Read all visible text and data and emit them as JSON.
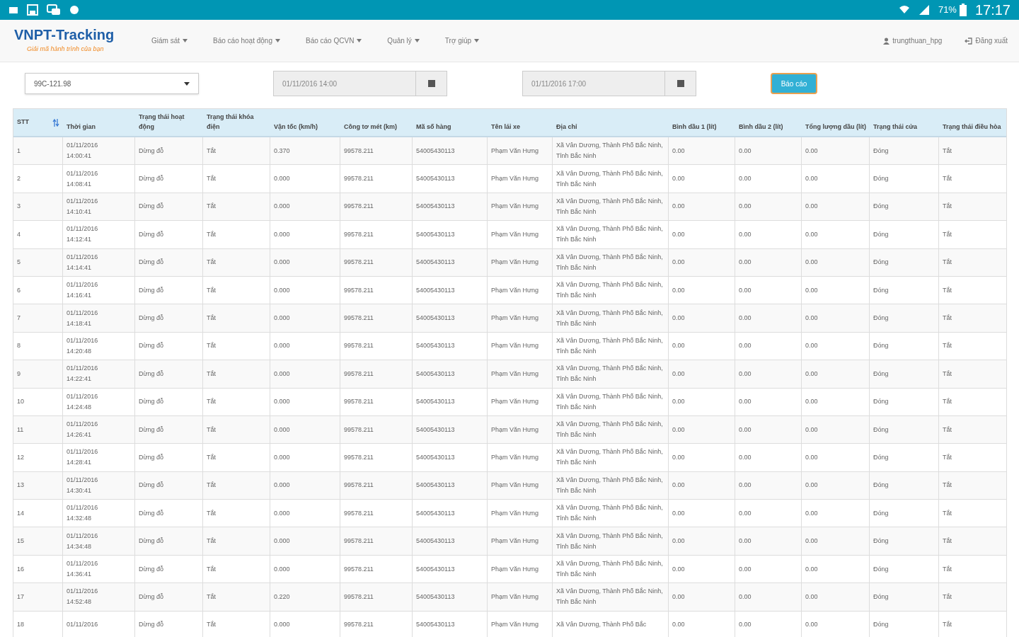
{
  "status_bar": {
    "battery": "71%",
    "time": "17:17"
  },
  "navbar": {
    "logo": "VNPT-Tracking",
    "logo_tagline": "Giải mã hành trình của bạn",
    "menu": [
      {
        "label": "Giám sát"
      },
      {
        "label": "Báo cáo hoạt động"
      },
      {
        "label": "Báo cáo QCVN"
      },
      {
        "label": "Quản lý"
      },
      {
        "label": "Trợ giúp"
      }
    ],
    "user": "trungthuan_hpg",
    "logout": "Đăng xuất"
  },
  "filters": {
    "vehicle": "99C-121.98",
    "from": "01/11/2016 14:00",
    "to": "01/11/2016 17:00",
    "report_button": "Báo cáo"
  },
  "table": {
    "columns": [
      "STT",
      "Thời gian",
      "Trạng thái hoạt động",
      "Trạng thái khóa điện",
      "Vận tốc (km/h)",
      "Công tơ mét (km)",
      "Mã số hàng",
      "Tên lái xe",
      "Địa chỉ",
      "Bình dầu 1 (lít)",
      "Bình dầu 2 (lít)",
      "Tổng lượng dầu (lít)",
      "Trạng thái cửa",
      "Trạng thái điều hòa"
    ],
    "rows": [
      [
        "1",
        "01/11/2016 14:00:41",
        "Dừng đỗ",
        "Tắt",
        "0.370",
        "99578.211",
        "54005430113",
        "Phạm Văn Hưng",
        "Xã Vân Dương, Thành Phố Bắc Ninh, Tỉnh Bắc Ninh",
        "0.00",
        "0.00",
        "0.00",
        "Đóng",
        "Tắt"
      ],
      [
        "2",
        "01/11/2016 14:08:41",
        "Dừng đỗ",
        "Tắt",
        "0.000",
        "99578.211",
        "54005430113",
        "Phạm Văn Hưng",
        "Xã Vân Dương, Thành Phố Bắc Ninh, Tỉnh Bắc Ninh",
        "0.00",
        "0.00",
        "0.00",
        "Đóng",
        "Tắt"
      ],
      [
        "3",
        "01/11/2016 14:10:41",
        "Dừng đỗ",
        "Tắt",
        "0.000",
        "99578.211",
        "54005430113",
        "Phạm Văn Hưng",
        "Xã Vân Dương, Thành Phố Bắc Ninh, Tỉnh Bắc Ninh",
        "0.00",
        "0.00",
        "0.00",
        "Đóng",
        "Tắt"
      ],
      [
        "4",
        "01/11/2016 14:12:41",
        "Dừng đỗ",
        "Tắt",
        "0.000",
        "99578.211",
        "54005430113",
        "Phạm Văn Hưng",
        "Xã Vân Dương, Thành Phố Bắc Ninh, Tỉnh Bắc Ninh",
        "0.00",
        "0.00",
        "0.00",
        "Đóng",
        "Tắt"
      ],
      [
        "5",
        "01/11/2016 14:14:41",
        "Dừng đỗ",
        "Tắt",
        "0.000",
        "99578.211",
        "54005430113",
        "Phạm Văn Hưng",
        "Xã Vân Dương, Thành Phố Bắc Ninh, Tỉnh Bắc Ninh",
        "0.00",
        "0.00",
        "0.00",
        "Đóng",
        "Tắt"
      ],
      [
        "6",
        "01/11/2016 14:16:41",
        "Dừng đỗ",
        "Tắt",
        "0.000",
        "99578.211",
        "54005430113",
        "Phạm Văn Hưng",
        "Xã Vân Dương, Thành Phố Bắc Ninh, Tỉnh Bắc Ninh",
        "0.00",
        "0.00",
        "0.00",
        "Đóng",
        "Tắt"
      ],
      [
        "7",
        "01/11/2016 14:18:41",
        "Dừng đỗ",
        "Tắt",
        "0.000",
        "99578.211",
        "54005430113",
        "Phạm Văn Hưng",
        "Xã Vân Dương, Thành Phố Bắc Ninh, Tỉnh Bắc Ninh",
        "0.00",
        "0.00",
        "0.00",
        "Đóng",
        "Tắt"
      ],
      [
        "8",
        "01/11/2016 14:20:48",
        "Dừng đỗ",
        "Tắt",
        "0.000",
        "99578.211",
        "54005430113",
        "Phạm Văn Hưng",
        "Xã Vân Dương, Thành Phố Bắc Ninh, Tỉnh Bắc Ninh",
        "0.00",
        "0.00",
        "0.00",
        "Đóng",
        "Tắt"
      ],
      [
        "9",
        "01/11/2016 14:22:41",
        "Dừng đỗ",
        "Tắt",
        "0.000",
        "99578.211",
        "54005430113",
        "Phạm Văn Hưng",
        "Xã Vân Dương, Thành Phố Bắc Ninh, Tỉnh Bắc Ninh",
        "0.00",
        "0.00",
        "0.00",
        "Đóng",
        "Tắt"
      ],
      [
        "10",
        "01/11/2016 14:24:48",
        "Dừng đỗ",
        "Tắt",
        "0.000",
        "99578.211",
        "54005430113",
        "Phạm Văn Hưng",
        "Xã Vân Dương, Thành Phố Bắc Ninh, Tỉnh Bắc Ninh",
        "0.00",
        "0.00",
        "0.00",
        "Đóng",
        "Tắt"
      ],
      [
        "11",
        "01/11/2016 14:26:41",
        "Dừng đỗ",
        "Tắt",
        "0.000",
        "99578.211",
        "54005430113",
        "Phạm Văn Hưng",
        "Xã Vân Dương, Thành Phố Bắc Ninh, Tỉnh Bắc Ninh",
        "0.00",
        "0.00",
        "0.00",
        "Đóng",
        "Tắt"
      ],
      [
        "12",
        "01/11/2016 14:28:41",
        "Dừng đỗ",
        "Tắt",
        "0.000",
        "99578.211",
        "54005430113",
        "Phạm Văn Hưng",
        "Xã Vân Dương, Thành Phố Bắc Ninh, Tỉnh Bắc Ninh",
        "0.00",
        "0.00",
        "0.00",
        "Đóng",
        "Tắt"
      ],
      [
        "13",
        "01/11/2016 14:30:41",
        "Dừng đỗ",
        "Tắt",
        "0.000",
        "99578.211",
        "54005430113",
        "Phạm Văn Hưng",
        "Xã Vân Dương, Thành Phố Bắc Ninh, Tỉnh Bắc Ninh",
        "0.00",
        "0.00",
        "0.00",
        "Đóng",
        "Tắt"
      ],
      [
        "14",
        "01/11/2016 14:32:48",
        "Dừng đỗ",
        "Tắt",
        "0.000",
        "99578.211",
        "54005430113",
        "Phạm Văn Hưng",
        "Xã Vân Dương, Thành Phố Bắc Ninh, Tỉnh Bắc Ninh",
        "0.00",
        "0.00",
        "0.00",
        "Đóng",
        "Tắt"
      ],
      [
        "15",
        "01/11/2016 14:34:48",
        "Dừng đỗ",
        "Tắt",
        "0.000",
        "99578.211",
        "54005430113",
        "Phạm Văn Hưng",
        "Xã Vân Dương, Thành Phố Bắc Ninh, Tỉnh Bắc Ninh",
        "0.00",
        "0.00",
        "0.00",
        "Đóng",
        "Tắt"
      ],
      [
        "16",
        "01/11/2016 14:36:41",
        "Dừng đỗ",
        "Tắt",
        "0.000",
        "99578.211",
        "54005430113",
        "Phạm Văn Hưng",
        "Xã Vân Dương, Thành Phố Bắc Ninh, Tỉnh Bắc Ninh",
        "0.00",
        "0.00",
        "0.00",
        "Đóng",
        "Tắt"
      ],
      [
        "17",
        "01/11/2016 14:52:48",
        "Dừng đỗ",
        "Tắt",
        "0.220",
        "99578.211",
        "54005430113",
        "Phạm Văn Hưng",
        "Xã Vân Dương, Thành Phố Bắc Ninh, Tỉnh Bắc Ninh",
        "0.00",
        "0.00",
        "0.00",
        "Đóng",
        "Tắt"
      ],
      [
        "18",
        "01/11/2016",
        "Dừng đỗ",
        "Tắt",
        "0.000",
        "99578.211",
        "54005430113",
        "Phạm Văn Hưng",
        "Xã Vân Dương, Thành Phố Bắc",
        "0.00",
        "0.00",
        "0.00",
        "Đóng",
        "Tắt"
      ]
    ]
  }
}
